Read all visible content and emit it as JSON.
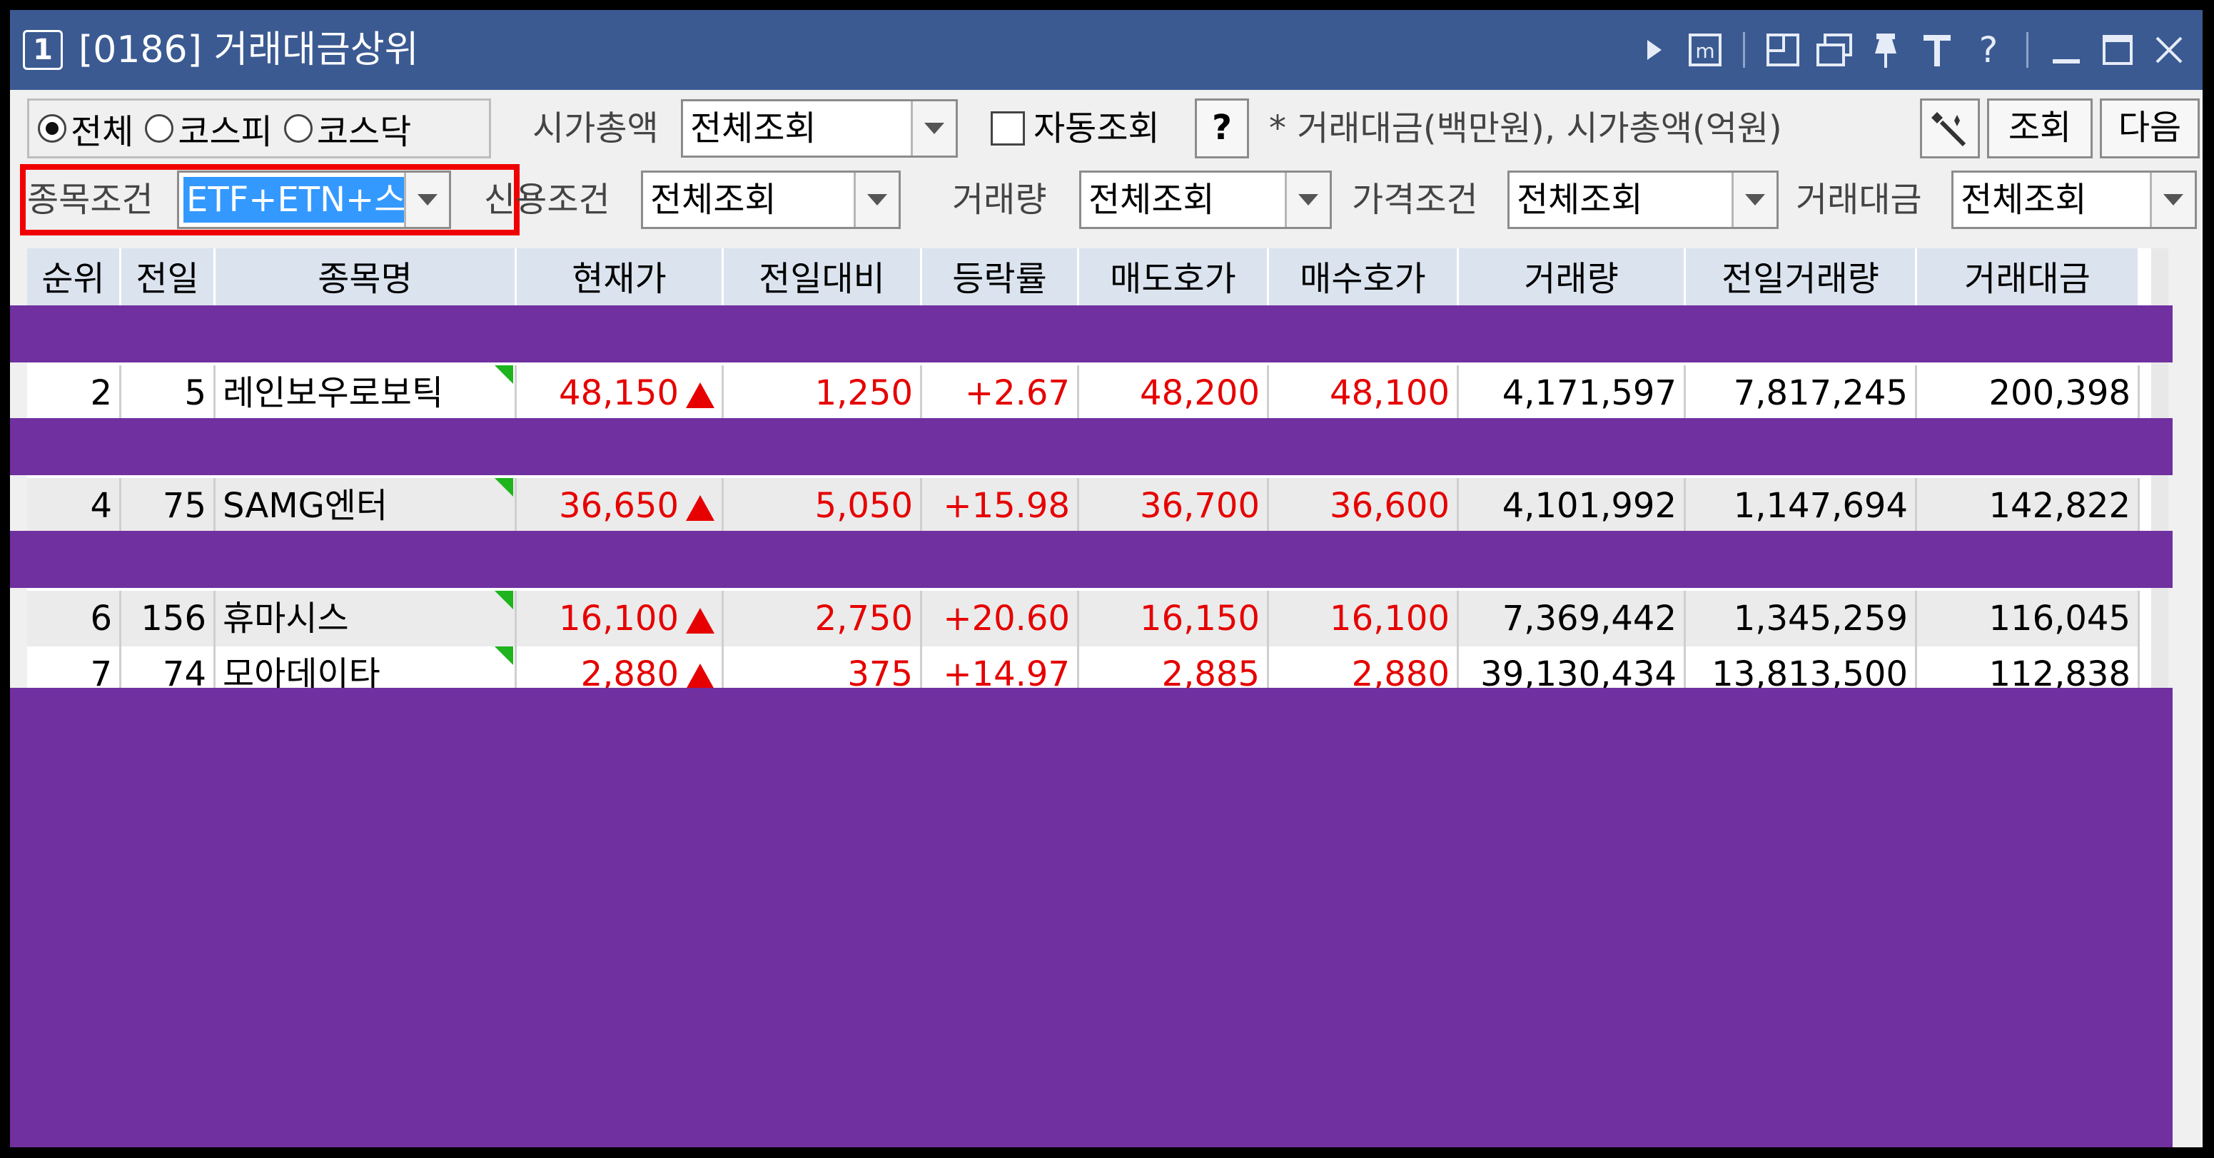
{
  "window": {
    "number": "1",
    "title": "[0186] 거래대금상위",
    "title_icons": [
      "play-icon",
      "memo-icon",
      "layout-icon",
      "window-icon",
      "pin-icon",
      "font-icon",
      "help-icon",
      "minimize-icon",
      "maximize-icon",
      "close-icon"
    ]
  },
  "filters": {
    "market_options": [
      "전체",
      "코스피",
      "코스닥"
    ],
    "market_selected": "전체",
    "market_cap_label": "시가총액",
    "market_cap_value": "전체조회",
    "auto_query_label": "자동조회",
    "help_btn": "?",
    "units_note": "* 거래대금(백만원), 시가총액(억원)",
    "query_btn": "조회",
    "next_btn": "다음",
    "stock_cond_label": "종목조건",
    "stock_cond_value": "ETF+ETN+스팩",
    "credit_cond_label": "신용조건",
    "credit_cond_value": "전체조회",
    "volume_label": "거래량",
    "volume_value": "전체조회",
    "price_cond_label": "가격조건",
    "price_cond_value": "전체조회",
    "trade_amt_label": "거래대금",
    "trade_amt_value": "전체조회"
  },
  "table": {
    "headers": [
      "순위",
      "전일",
      "종목명",
      "현재가",
      "전일대비",
      "등락률",
      "매도호가",
      "매수호가",
      "거래량",
      "전일거래량",
      "거래대금"
    ],
    "rows": [
      {
        "rank": "2",
        "prev": "5",
        "name": "레인보우로보틱",
        "price": "48,150",
        "change": "1,250",
        "rate": "+2.67",
        "ask": "48,200",
        "bid": "48,100",
        "volume": "4,171,597",
        "prev_volume": "7,817,245",
        "amount": "200,398"
      },
      {
        "rank": "4",
        "prev": "75",
        "name": "SAMG엔터",
        "price": "36,650",
        "change": "5,050",
        "rate": "+15.98",
        "ask": "36,700",
        "bid": "36,600",
        "volume": "4,101,992",
        "prev_volume": "1,147,694",
        "amount": "142,822"
      },
      {
        "rank": "6",
        "prev": "156",
        "name": "휴마시스",
        "price": "16,100",
        "change": "2,750",
        "rate": "+20.60",
        "ask": "16,150",
        "bid": "16,100",
        "volume": "7,369,442",
        "prev_volume": "1,345,259",
        "amount": "116,045"
      },
      {
        "rank": "7",
        "prev": "74",
        "name": "모아데이타",
        "price": "2,880",
        "change": "375",
        "rate": "+14.97",
        "ask": "2,885",
        "bid": "2,880",
        "volume": "39,130,434",
        "prev_volume": "13,813,500",
        "amount": "112,838"
      }
    ]
  },
  "colors": {
    "title_bar": "#3b5a92",
    "mask": "#7030a0",
    "up": "#e60000",
    "highlight": "#f00000",
    "header_bg": "#dbe3ee",
    "flag": "#1db41d"
  }
}
